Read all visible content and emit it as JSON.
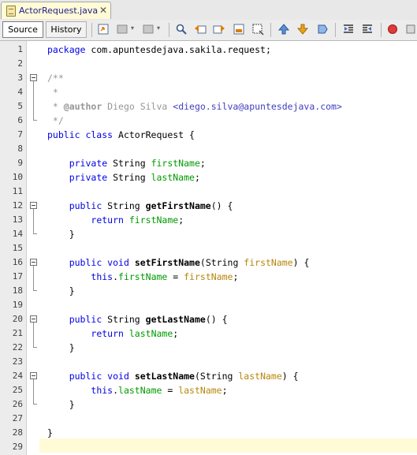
{
  "editor": {
    "tab": {
      "filename": "ActorRequest.java",
      "close_glyph": "✕"
    },
    "toolbar": {
      "source_label": "Source",
      "history_label": "History"
    },
    "current_line": 29
  },
  "lines": [
    {
      "n": "1",
      "tokens": [
        [
          "kw",
          "package"
        ],
        [
          "t",
          " com.apuntesdejava.sakila.request;"
        ]
      ]
    },
    {
      "n": "2",
      "tokens": []
    },
    {
      "n": "3",
      "tokens": [
        [
          "cm",
          "/**"
        ]
      ]
    },
    {
      "n": "4",
      "tokens": [
        [
          "cm",
          " *"
        ]
      ]
    },
    {
      "n": "5",
      "tokens": [
        [
          "cm",
          " * "
        ],
        [
          "cmtag",
          "@author"
        ],
        [
          "cm",
          " Diego Silva "
        ],
        [
          "link",
          "<diego.silva@apuntesdejava.com>"
        ]
      ]
    },
    {
      "n": "6",
      "tokens": [
        [
          "cm",
          " */"
        ]
      ]
    },
    {
      "n": "7",
      "tokens": [
        [
          "kw",
          "public class"
        ],
        [
          "t",
          " ActorRequest {"
        ]
      ]
    },
    {
      "n": "8",
      "tokens": []
    },
    {
      "n": "9",
      "tokens": [
        [
          "t",
          "    "
        ],
        [
          "kw",
          "private"
        ],
        [
          "t",
          " String "
        ],
        [
          "fld",
          "firstName"
        ],
        [
          "t",
          ";"
        ]
      ]
    },
    {
      "n": "10",
      "tokens": [
        [
          "t",
          "    "
        ],
        [
          "kw",
          "private"
        ],
        [
          "t",
          " String "
        ],
        [
          "fld",
          "lastName"
        ],
        [
          "t",
          ";"
        ]
      ]
    },
    {
      "n": "11",
      "tokens": []
    },
    {
      "n": "12",
      "tokens": [
        [
          "t",
          "    "
        ],
        [
          "kw",
          "public"
        ],
        [
          "t",
          " String "
        ],
        [
          "mth",
          "getFirstName"
        ],
        [
          "t",
          "() {"
        ]
      ]
    },
    {
      "n": "13",
      "tokens": [
        [
          "t",
          "        "
        ],
        [
          "kw",
          "return"
        ],
        [
          "t",
          " "
        ],
        [
          "fld",
          "firstName"
        ],
        [
          "t",
          ";"
        ]
      ]
    },
    {
      "n": "14",
      "tokens": [
        [
          "t",
          "    }"
        ]
      ]
    },
    {
      "n": "15",
      "tokens": []
    },
    {
      "n": "16",
      "tokens": [
        [
          "t",
          "    "
        ],
        [
          "kw",
          "public void"
        ],
        [
          "t",
          " "
        ],
        [
          "mth",
          "setFirstName"
        ],
        [
          "t",
          "(String "
        ],
        [
          "prm",
          "firstName"
        ],
        [
          "t",
          ") {"
        ]
      ]
    },
    {
      "n": "17",
      "tokens": [
        [
          "t",
          "        "
        ],
        [
          "kw",
          "this"
        ],
        [
          "t",
          "."
        ],
        [
          "fld",
          "firstName"
        ],
        [
          "t",
          " = "
        ],
        [
          "prm",
          "firstName"
        ],
        [
          "t",
          ";"
        ]
      ]
    },
    {
      "n": "18",
      "tokens": [
        [
          "t",
          "    }"
        ]
      ]
    },
    {
      "n": "19",
      "tokens": []
    },
    {
      "n": "20",
      "tokens": [
        [
          "t",
          "    "
        ],
        [
          "kw",
          "public"
        ],
        [
          "t",
          " String "
        ],
        [
          "mth",
          "getLastName"
        ],
        [
          "t",
          "() {"
        ]
      ]
    },
    {
      "n": "21",
      "tokens": [
        [
          "t",
          "        "
        ],
        [
          "kw",
          "return"
        ],
        [
          "t",
          " "
        ],
        [
          "fld",
          "lastName"
        ],
        [
          "t",
          ";"
        ]
      ]
    },
    {
      "n": "22",
      "tokens": [
        [
          "t",
          "    }"
        ]
      ]
    },
    {
      "n": "23",
      "tokens": []
    },
    {
      "n": "24",
      "tokens": [
        [
          "t",
          "    "
        ],
        [
          "kw",
          "public void"
        ],
        [
          "t",
          " "
        ],
        [
          "mth",
          "setLastName"
        ],
        [
          "t",
          "(String "
        ],
        [
          "prm",
          "lastName"
        ],
        [
          "t",
          ") {"
        ]
      ]
    },
    {
      "n": "25",
      "tokens": [
        [
          "t",
          "        "
        ],
        [
          "kw",
          "this"
        ],
        [
          "t",
          "."
        ],
        [
          "fld",
          "lastName"
        ],
        [
          "t",
          " = "
        ],
        [
          "prm",
          "lastName"
        ],
        [
          "t",
          ";"
        ]
      ]
    },
    {
      "n": "26",
      "tokens": [
        [
          "t",
          "    }"
        ]
      ]
    },
    {
      "n": "27",
      "tokens": []
    },
    {
      "n": "28",
      "tokens": [
        [
          "t",
          "}"
        ]
      ]
    },
    {
      "n": "29",
      "tokens": []
    }
  ],
  "folds": [
    {
      "start": 3,
      "end": 6
    },
    {
      "start": 12,
      "end": 14
    },
    {
      "start": 16,
      "end": 18
    },
    {
      "start": 20,
      "end": 22
    },
    {
      "start": 24,
      "end": 26
    }
  ],
  "colors": {
    "keyword": "#0000e6",
    "comment": "#969696",
    "field": "#009900",
    "parameter": "#b8860b",
    "link": "#3f3fbf",
    "current_line": "#fffbd6",
    "tab_bg": "#fffbd6"
  }
}
